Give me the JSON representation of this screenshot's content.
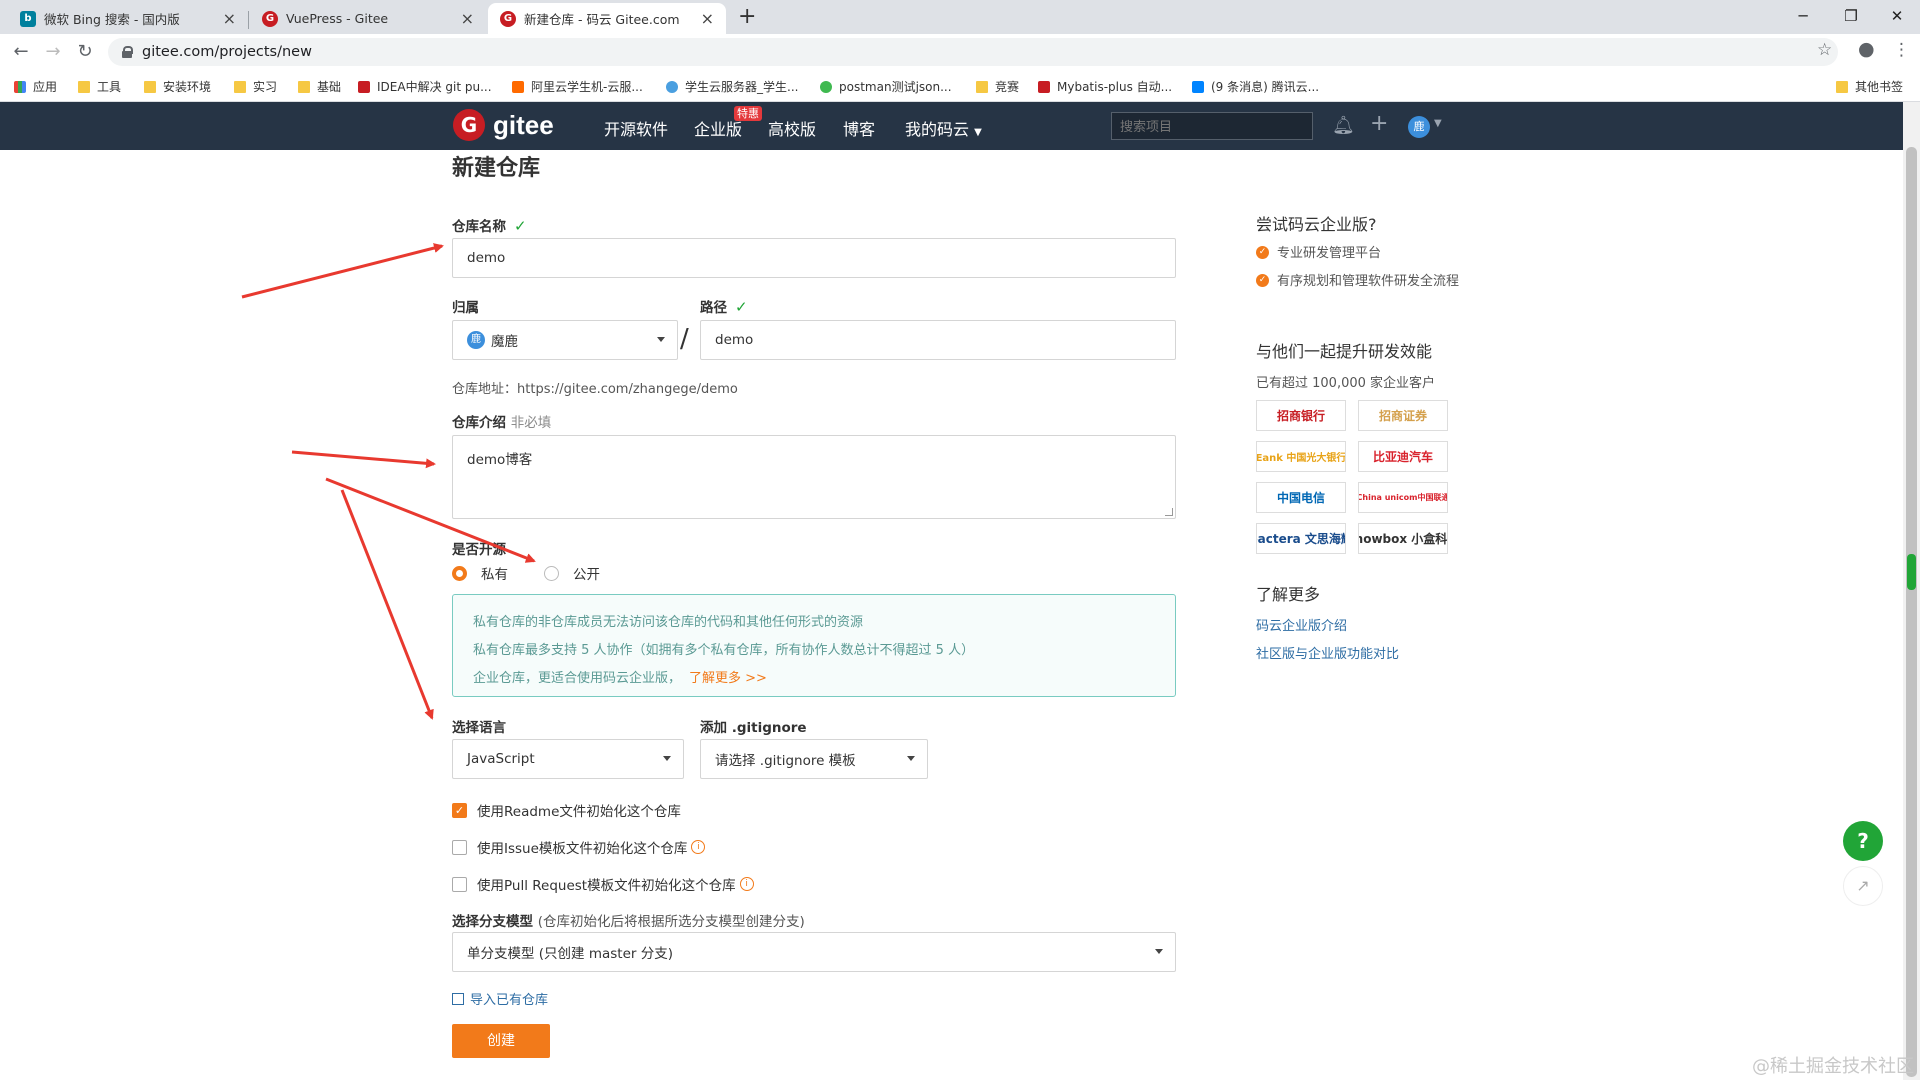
{
  "browser": {
    "tabs": [
      {
        "title": "微软 Bing 搜索 - 国内版",
        "favicon": "bing-icon",
        "active": false
      },
      {
        "title": "VuePress - Gitee",
        "favicon": "gitee-icon",
        "active": false
      },
      {
        "title": "新建仓库 - 码云 Gitee.com",
        "favicon": "gitee-icon",
        "active": true
      }
    ],
    "url": "gitee.com/projects/new",
    "bookmarks": [
      {
        "label": "应用",
        "icon": "apps-icon"
      },
      {
        "label": "工具",
        "icon": "folder-icon"
      },
      {
        "label": "安装环境",
        "icon": "folder-icon"
      },
      {
        "label": "实习",
        "icon": "folder-icon"
      },
      {
        "label": "基础",
        "icon": "folder-icon"
      },
      {
        "label": "IDEA中解决 git pu...",
        "icon": "csdn-icon"
      },
      {
        "label": "阿里云学生机-云服...",
        "icon": "aliyun-icon"
      },
      {
        "label": "学生云服务器_学生...",
        "icon": "cloud-icon"
      },
      {
        "label": "postman测试json...",
        "icon": "green-icon"
      },
      {
        "label": "竞赛",
        "icon": "folder-icon"
      },
      {
        "label": "Mybatis-plus 自动...",
        "icon": "csdn-icon"
      },
      {
        "label": "(9 条消息) 腾讯云...",
        "icon": "zhihu-icon"
      },
      {
        "label": "其他书签",
        "icon": "folder-icon"
      }
    ]
  },
  "header": {
    "logo_text": "gitee",
    "nav": [
      "开源软件",
      "企业版",
      "高校版",
      "博客",
      "我的码云"
    ],
    "badge": "特惠",
    "search_placeholder": "搜索项目",
    "avatar_text": "鹿"
  },
  "form": {
    "title": "新建仓库",
    "repo_name_label": "仓库名称",
    "repo_name_value": "demo",
    "owner_label": "归属",
    "owner_value": "魔鹿",
    "path_label": "路径",
    "path_value": "demo",
    "address_label": "仓库地址：",
    "address_value": "https://gitee.com/zhangege/demo",
    "intro_label": "仓库介绍",
    "intro_hint": "非必填",
    "intro_value": "demo博客",
    "open_label": "是否开源",
    "radio_private": "私有",
    "radio_public": "公开",
    "info_lines": [
      "私有仓库的非仓库成员无法访问该仓库的代码和其他任何形式的资源",
      "私有仓库最多支持 5 人协作（如拥有多个私有仓库，所有协作人数总计不得超过 5 人）",
      "企业仓库，更适合使用码云企业版，"
    ],
    "info_link": "了解更多 >>",
    "language_label": "选择语言",
    "language_value": "JavaScript",
    "gitignore_label": "添加 .gitignore",
    "gitignore_value": "请选择 .gitignore 模板",
    "check_readme": "使用Readme文件初始化这个仓库",
    "check_issue": "使用Issue模板文件初始化这个仓库",
    "check_pr": "使用Pull Request模板文件初始化这个仓库",
    "branch_label": "选择分支模型",
    "branch_hint": "(仓库初始化后将根据所选分支模型创建分支)",
    "branch_value": "单分支模型 (只创建 master 分支)",
    "import_link": "导入已有仓库",
    "create_button": "创建"
  },
  "sidebar": {
    "try_title": "尝试码云企业版?",
    "features": [
      "专业研发管理平台",
      "有序规划和管理软件研发全流程"
    ],
    "together_title": "与他们一起提升研发效能",
    "customers_text": "已有超过 100,000 家企业客户",
    "logos": [
      "招商银行",
      "招商证券",
      "Eank 中国光大银行",
      "比亚迪汽车",
      "中国电信",
      "China unicom中国联通",
      "pactera 文思海辉",
      "knowbox 小盒科技"
    ],
    "learn_more_title": "了解更多",
    "links": [
      "码云企业版介绍",
      "社区版与企业版功能对比"
    ]
  },
  "watermark": "@稀土掘金技术社区"
}
